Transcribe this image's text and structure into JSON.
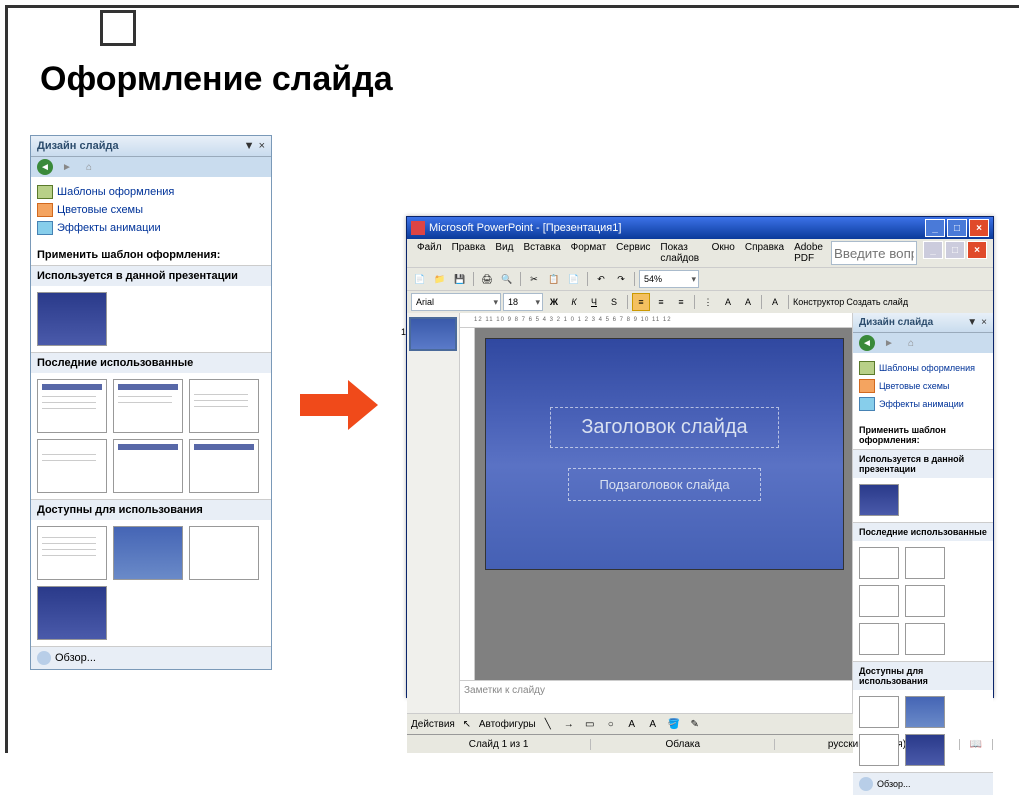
{
  "page_title": "Оформление слайда",
  "design_pane": {
    "title": "Дизайн слайда",
    "links": {
      "templates": "Шаблоны оформления",
      "schemes": "Цветовые схемы",
      "anim": "Эффекты анимации"
    },
    "apply_label": "Применить шаблон оформления:",
    "group_used": "Используется в данной презентации",
    "group_recent": "Последние использованные",
    "group_avail": "Доступны для использования",
    "browse": "Обзор..."
  },
  "app": {
    "title": "Microsoft PowerPoint - [Презентация1]",
    "menus": [
      "Файл",
      "Правка",
      "Вид",
      "Вставка",
      "Формат",
      "Сервис",
      "Показ слайдов",
      "Окно",
      "Справка",
      "Adobe PDF"
    ],
    "help_placeholder": "Введите вопрос",
    "font": "Arial",
    "font_size": "18",
    "zoom": "54%",
    "designer_btn": "Конструктор",
    "new_slide_btn": "Создать слайд",
    "ruler_text": "12 11 10 9 8 7 6 5 4 3 2 1 0 1 2 3 4 5 6 7 8 9 10 11 12",
    "slide_title_ph": "Заголовок слайда",
    "slide_sub_ph": "Подзаголовок слайда",
    "notes_ph": "Заметки к слайду",
    "actions": "Действия",
    "autofig": "Автофигуры",
    "status_slide": "Слайд 1 из 1",
    "status_theme": "Облака",
    "status_lang": "русский (Россия)"
  }
}
